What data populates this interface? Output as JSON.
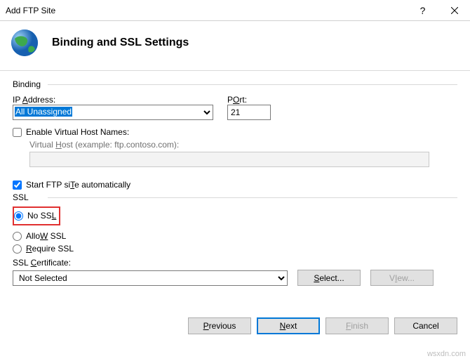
{
  "window": {
    "title": "Add FTP Site"
  },
  "header": {
    "heading": "Binding and SSL Settings"
  },
  "binding": {
    "group_label": "Binding",
    "ip_label": "IP Address:",
    "ip_label_u": "A",
    "ip_value": "All Unassigned",
    "port_label": "Port:",
    "port_label_u": "O",
    "port_value": "21",
    "enable_vhost_label": "Enable Virtual Host Names:",
    "enable_vhost_checked": false,
    "vhost_label": "Virtual Host (example: ftp.contoso.com):",
    "vhost_label_u": "H",
    "vhost_value": ""
  },
  "auto_start": {
    "label": "Start FTP site automatically",
    "label_u": "T",
    "checked": true
  },
  "ssl": {
    "group_label": "SSL",
    "no_ssl": "No SSL",
    "no_ssl_u": "L",
    "allow_ssl": "Allow SSL",
    "allow_ssl_u": "W",
    "require_ssl": "Require SSL",
    "require_ssl_u": "R",
    "selected": "no",
    "cert_label": "SSL Certificate:",
    "cert_label_u": "C",
    "cert_value": "Not Selected",
    "select_btn": "Select...",
    "select_btn_u": "S",
    "view_btn": "View...",
    "view_btn_u": "I"
  },
  "footer": {
    "previous": "Previous",
    "previous_u": "P",
    "next": "Next",
    "next_u": "N",
    "finish": "Finish",
    "finish_u": "F",
    "cancel": "Cancel"
  },
  "watermark": "wsxdn.com"
}
